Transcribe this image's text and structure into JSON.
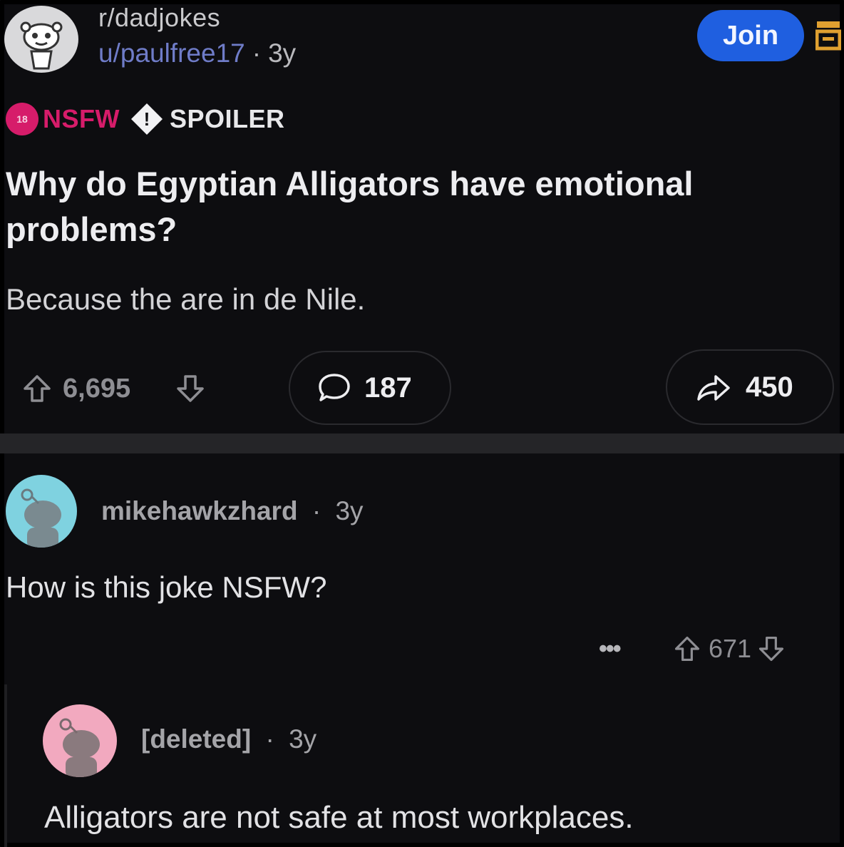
{
  "post": {
    "subreddit": "r/dadjokes",
    "author": "u/paulfree17",
    "separator": "·",
    "age": "3y",
    "join_label": "Join",
    "nsfw_badge": "18",
    "nsfw_label": "NSFW",
    "spoiler_icon": "!",
    "spoiler_label": "SPOILER",
    "title": "Why do Egyptian Alligators have emotional problems?",
    "body": "Because the are in de Nile.",
    "upvotes": "6,695",
    "comments": "187",
    "shares": "450"
  },
  "comments": [
    {
      "user": "mikehawkzhard",
      "separator": "·",
      "age": "3y",
      "text": "How is this joke NSFW?",
      "more_label": "•••",
      "votes": "671",
      "avatar_color": "#7fd2e0"
    },
    {
      "user": "[deleted]",
      "separator": "·",
      "age": "3y",
      "text": "Alligators are not safe at most workplaces.",
      "avatar_color": "#f2a9bf"
    }
  ],
  "icons": {
    "subreddit_avatar": "snoo-avatar-icon",
    "menu": "menu-icon",
    "upvote": "upvote-arrow-icon",
    "downvote": "downvote-arrow-icon",
    "comment": "comment-bubble-icon",
    "share": "share-arrow-icon"
  },
  "colors": {
    "background": "#0d0d10",
    "join_button": "#1f5fe0",
    "nsfw": "#d61c6a",
    "author_link": "#6f7cc8"
  }
}
